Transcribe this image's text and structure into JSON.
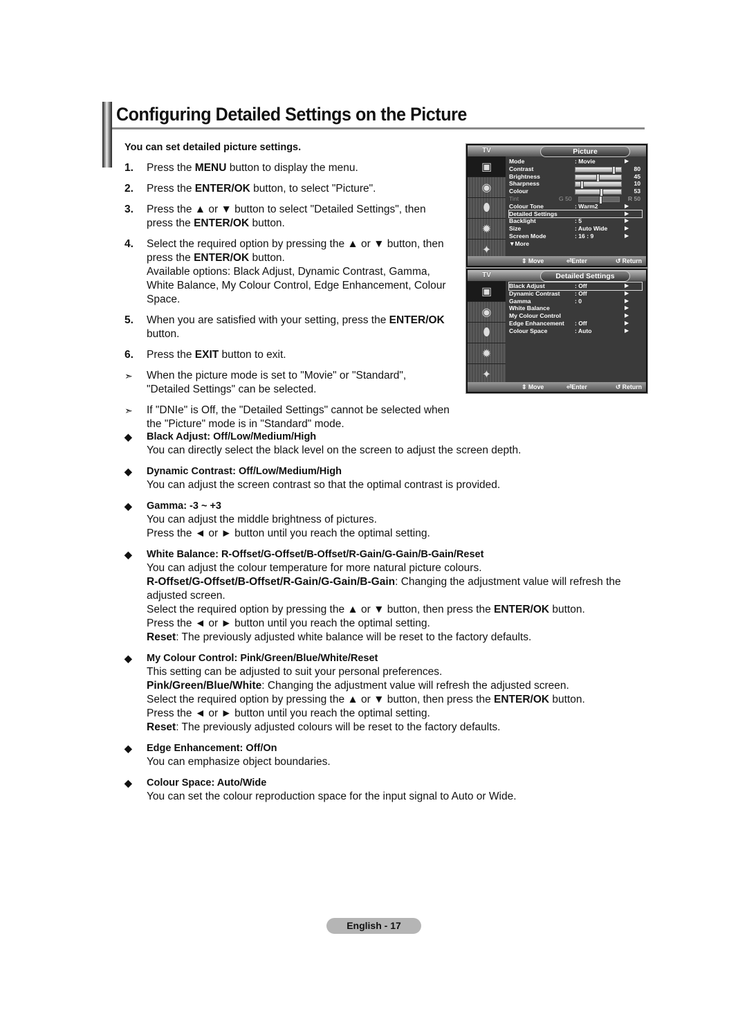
{
  "page": {
    "title": "Configuring Detailed Settings on the Picture",
    "intro": "You can set detailed picture settings.",
    "page_label": "English - 17"
  },
  "steps": [
    {
      "num": "1.",
      "parts": [
        [
          "Press the ",
          false
        ],
        [
          "MENU",
          true
        ],
        [
          " button to display the menu.",
          false
        ]
      ]
    },
    {
      "num": "2.",
      "parts": [
        [
          "Press the ",
          false
        ],
        [
          "ENTER/OK",
          true
        ],
        [
          " button, to select \"Picture\".",
          false
        ]
      ]
    },
    {
      "num": "3.",
      "parts": [
        [
          "Press the ▲ or ▼ button to select \"Detailed Settings\", then press the ",
          false
        ],
        [
          "ENTER/OK",
          true
        ],
        [
          " button.",
          false
        ]
      ]
    },
    {
      "num": "4.",
      "parts": [
        [
          "Select the required option by pressing the ▲ or ▼ button, then press the ",
          false
        ],
        [
          "ENTER/OK",
          true
        ],
        [
          " button.\nAvailable options: Black Adjust, Dynamic Contrast, Gamma, White Balance, My Colour Control, Edge Enhancement, Colour Space.",
          false
        ]
      ]
    },
    {
      "num": "5.",
      "parts": [
        [
          "When you are satisfied with your setting, press the ",
          false
        ],
        [
          "ENTER/OK",
          true
        ],
        [
          " button.",
          false
        ]
      ]
    },
    {
      "num": "6.",
      "parts": [
        [
          "Press the ",
          false
        ],
        [
          "EXIT",
          true
        ],
        [
          " button to exit.",
          false
        ]
      ]
    },
    {
      "num": "➣",
      "note": true,
      "parts": [
        [
          "When the picture mode is set to \"Movie\" or \"Standard\", \"Detailed Settings\" can be selected.",
          false
        ]
      ]
    },
    {
      "num": "➣",
      "note": true,
      "parts": [
        [
          "If \"DNIe\" is Off, the \"Detailed Settings\" cannot be selected when the \"Picture\" mode is in \"Standard\" mode.",
          false
        ]
      ]
    }
  ],
  "sections": [
    {
      "head": "Black Adjust: Off/Low/Medium/High",
      "lines": [
        [
          [
            "You can directly select the black level on the screen to adjust the screen depth.",
            false
          ]
        ]
      ]
    },
    {
      "head": "Dynamic Contrast: Off/Low/Medium/High",
      "lines": [
        [
          [
            "You can adjust the screen contrast so that the optimal contrast is provided.",
            false
          ]
        ]
      ]
    },
    {
      "head": "Gamma: -3 ~ +3",
      "lines": [
        [
          [
            "You can adjust the middle brightness of pictures.",
            false
          ]
        ],
        [
          [
            "Press the ◄ or ► button until you reach the optimal setting.",
            false
          ]
        ]
      ]
    },
    {
      "head": "White Balance: R-Offset/G-Offset/B-Offset/R-Gain/G-Gain/B-Gain/Reset",
      "lines": [
        [
          [
            "You can adjust the colour temperature for more natural picture colours.",
            false
          ]
        ],
        [
          [
            "R-Offset/G-Offset/B-Offset/R-Gain/G-Gain/B-Gain",
            true
          ],
          [
            ": Changing the adjustment value will refresh the adjusted screen.",
            false
          ]
        ],
        [
          [
            "Select the required option by pressing the ▲ or ▼ button, then press the ",
            false
          ],
          [
            "ENTER/OK",
            true
          ],
          [
            " button.",
            false
          ]
        ],
        [
          [
            "Press the ◄ or ► button until you reach the optimal setting.",
            false
          ]
        ],
        [
          [
            "Reset",
            true
          ],
          [
            ": The previously adjusted white balance will be reset to the factory defaults.",
            false
          ]
        ]
      ]
    },
    {
      "head": "My Colour Control: Pink/Green/Blue/White/Reset",
      "lines": [
        [
          [
            "This setting can be adjusted to suit your personal preferences.",
            false
          ]
        ],
        [
          [
            "Pink/Green/Blue/White",
            true
          ],
          [
            ": Changing the adjustment value will refresh the adjusted screen.",
            false
          ]
        ],
        [
          [
            "Select the required option by pressing the ▲ or ▼ button, then press the ",
            false
          ],
          [
            "ENTER/OK",
            true
          ],
          [
            " button.",
            false
          ]
        ],
        [
          [
            "Press the ◄ or ► button until you reach the optimal setting.",
            false
          ]
        ],
        [
          [
            "Reset",
            true
          ],
          [
            ": The previously adjusted colours will be reset to the factory defaults.",
            false
          ]
        ]
      ]
    },
    {
      "head": "Edge Enhancement: Off/On",
      "lines": [
        [
          [
            "You can emphasize object boundaries.",
            false
          ]
        ]
      ]
    },
    {
      "head": "Colour Space: Auto/Wide",
      "lines": [
        [
          [
            "You can set the colour reproduction space for the input signal to Auto or Wide.",
            false
          ]
        ]
      ]
    }
  ],
  "tv_menu_picture": {
    "label": "TV",
    "tab": "Picture",
    "items": [
      {
        "label": "Mode",
        "value": ": Movie",
        "arrow": true
      },
      {
        "label": "Contrast",
        "slider": 80,
        "num": "80"
      },
      {
        "label": "Brightness",
        "slider": 45,
        "num": "45"
      },
      {
        "label": "Sharpness",
        "slider": 10,
        "num": "10"
      },
      {
        "label": "Colour",
        "slider": 53,
        "num": "53"
      },
      {
        "label": "Tint",
        "slider": 50,
        "left": "G 50",
        "num": "R 50",
        "dim": true
      },
      {
        "label": "Colour Tone",
        "value": ": Warm2",
        "arrow": true
      },
      {
        "label": "Detailed Settings",
        "value": "",
        "arrow": true,
        "selected": true
      },
      {
        "label": "Backlight",
        "value": ": 5",
        "arrow": true
      },
      {
        "label": "Size",
        "value": ": Auto Wide",
        "arrow": true
      },
      {
        "label": "Screen Mode",
        "value": ": 16 : 9",
        "arrow": true
      },
      {
        "label": "▼More",
        "value": ""
      }
    ],
    "footer": {
      "move": "⇕ Move",
      "enter": "⏎Enter",
      "return": "↺ Return"
    }
  },
  "tv_menu_detailed": {
    "label": "TV",
    "tab": "Detailed Settings",
    "items": [
      {
        "label": "Black Adjust",
        "value": ": Off",
        "arrow": true,
        "selected": true
      },
      {
        "label": "Dynamic Contrast",
        "value": ": Off",
        "arrow": true
      },
      {
        "label": "Gamma",
        "value": ": 0",
        "arrow": true
      },
      {
        "label": "White Balance",
        "value": "",
        "arrow": true
      },
      {
        "label": "My Colour Control",
        "value": "",
        "arrow": true
      },
      {
        "label": "Edge Enhancement",
        "value": ": Off",
        "arrow": true
      },
      {
        "label": "Colour Space",
        "value": ": Auto",
        "arrow": true
      }
    ],
    "footer": {
      "move": "⇕ Move",
      "enter": "⏎Enter",
      "return": "↺ Return"
    }
  },
  "tv_sidebar_icons": [
    "picture-icon",
    "sound-icon",
    "channel-icon",
    "setup-icon",
    "input-icon"
  ]
}
